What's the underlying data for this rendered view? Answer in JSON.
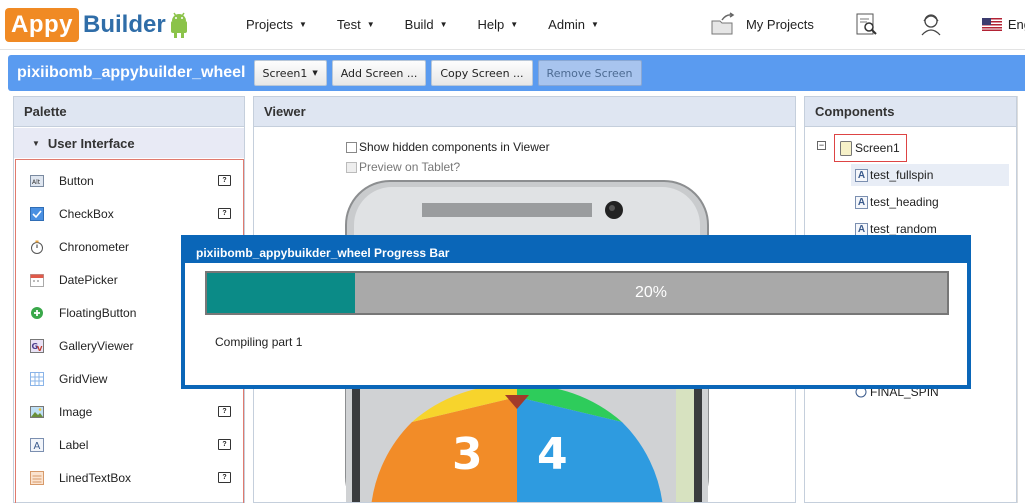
{
  "app": {
    "logo_part1": "Appy",
    "logo_part2": "Builder"
  },
  "menu": [
    {
      "label": "Projects"
    },
    {
      "label": "Test"
    },
    {
      "label": "Build"
    },
    {
      "label": "Help"
    },
    {
      "label": "Admin"
    }
  ],
  "right_nav": {
    "my_projects": "My Projects",
    "language": "Eng"
  },
  "project": {
    "name": "pixiibomb_appybuilder_wheel",
    "screen_select": "Screen1",
    "add_screen": "Add Screen ...",
    "copy_screen": "Copy Screen ...",
    "remove_screen": "Remove Screen"
  },
  "palette": {
    "title": "Palette",
    "group": "User Interface",
    "items": [
      {
        "label": "Button",
        "icon": "button-icon",
        "help": true
      },
      {
        "label": "CheckBox",
        "icon": "checkbox-icon",
        "help": true
      },
      {
        "label": "Chronometer",
        "icon": "stopwatch-icon",
        "help": false
      },
      {
        "label": "DatePicker",
        "icon": "calendar-icon",
        "help": false
      },
      {
        "label": "FloatingButton",
        "icon": "plus-circle-icon",
        "help": false
      },
      {
        "label": "GalleryViewer",
        "icon": "gallery-icon",
        "help": false
      },
      {
        "label": "GridView",
        "icon": "grid-icon",
        "help": false
      },
      {
        "label": "Image",
        "icon": "image-icon",
        "help": true
      },
      {
        "label": "Label",
        "icon": "label-icon",
        "help": true
      },
      {
        "label": "LinedTextBox",
        "icon": "lined-textbox-icon",
        "help": true
      }
    ]
  },
  "viewer": {
    "title": "Viewer",
    "show_hidden": "Show hidden components in Viewer",
    "preview_tablet": "Preview on Tablet?"
  },
  "components": {
    "title": "Components",
    "screen": "Screen1",
    "items": [
      "test_fullspin",
      "test_heading",
      "test_random"
    ],
    "partial_item": "FINAL_SPIN"
  },
  "progress": {
    "title": "pixiibomb_appybuikder_wheel Progress Bar",
    "percent_label": "20%",
    "percent_value": 0.2,
    "status": "Compiling part 1"
  },
  "colors": {
    "project_bar": "#5a9bf0",
    "modal_frame": "#0a66b8",
    "progress_fill": "#0b8b87",
    "logo_orange": "#f08a24"
  }
}
